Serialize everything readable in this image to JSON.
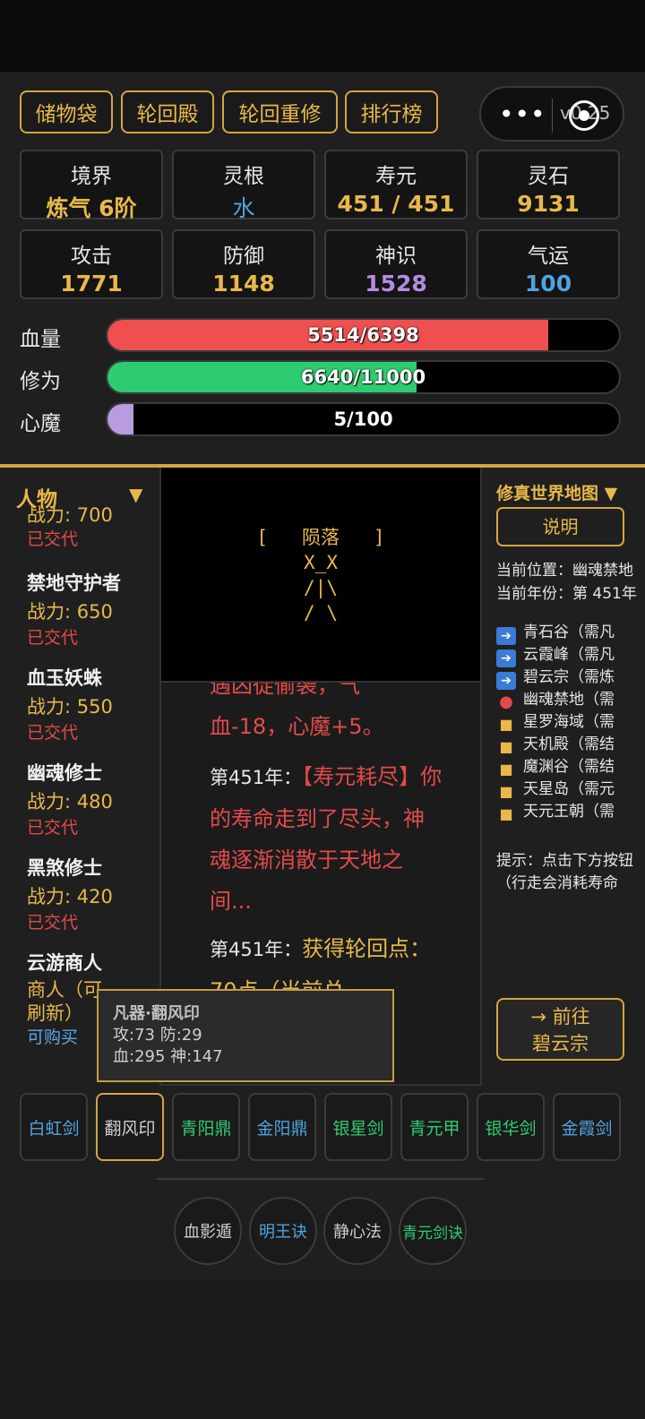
{
  "top_buttons": [
    "储物袋",
    "轮回殿",
    "轮回重修",
    "排行榜"
  ],
  "capsule": {
    "more": "•••",
    "version": "v0.25"
  },
  "stats": [
    {
      "label": "境界",
      "value": "炼气 6阶",
      "color": "#e8b84a"
    },
    {
      "label": "灵根",
      "value": "水",
      "color": "#4ea3e0"
    },
    {
      "label": "寿元",
      "value": "451 / 451",
      "color": "#e8b84a"
    },
    {
      "label": "灵石",
      "value": "9131",
      "color": "#e8b84a"
    },
    {
      "label": "攻击",
      "value": "1771",
      "color": "#e8b84a"
    },
    {
      "label": "防御",
      "value": "1148",
      "color": "#e8b84a"
    },
    {
      "label": "神识",
      "value": "1528",
      "color": "#b58be0"
    },
    {
      "label": "气运",
      "value": "100",
      "color": "#4ea3e0"
    }
  ],
  "bars": [
    {
      "label": "血量",
      "text": "5514/6398",
      "fraction": 0.862,
      "color": "#f04f4f"
    },
    {
      "label": "修为",
      "text": "6640/11000",
      "fraction": 0.604,
      "color": "#2ecc71"
    },
    {
      "label": "心魔",
      "text": "5/100",
      "fraction": 0.05,
      "color": "#b99be0"
    }
  ],
  "people": {
    "title": "人物",
    "toggle": "▼",
    "list": [
      {
        "name": "",
        "power": "战力: 700",
        "status": "已交代"
      },
      {
        "name": "禁地守护者",
        "power": "战力: 650",
        "status": "已交代"
      },
      {
        "name": "血玉妖蛛",
        "power": "战力: 550",
        "status": "已交代"
      },
      {
        "name": "幽魂修士",
        "power": "战力: 480",
        "status": "已交代"
      },
      {
        "name": "黑煞修士",
        "power": "战力: 420",
        "status": "已交代"
      },
      {
        "name": "云游商人",
        "power": "商人（可刷新）",
        "status": "可购买"
      }
    ]
  },
  "death_art": "[   陨落   ]\n X_X \n/|\\\n/ \\",
  "log": {
    "partial_top": "遇凶徒偷袭，气",
    "line1": "血-18，心魔+5。",
    "entry2_year": "第451年：",
    "entry2_text_a": "【寿元耗",
    "entry2_text_b": "尽】你的寿命走到了尽头，神魂逐渐消散于天地之间...",
    "entry3_year": "第451年：",
    "entry3_text": "获得轮回点：70点（当前总"
  },
  "map": {
    "title": "修真世界地图 ▼",
    "explain": "说明",
    "current_location": "当前位置：幽魂禁地",
    "current_year": "当前年份：第 451年",
    "locations": [
      {
        "icon": "arrow",
        "text": "青石谷（需凡"
      },
      {
        "icon": "arrow",
        "text": "云霞峰（需凡"
      },
      {
        "icon": "arrow",
        "text": "碧云宗（需炼"
      },
      {
        "icon": "pin",
        "text": "幽魂禁地（需"
      },
      {
        "icon": "lock",
        "text": "星罗海域（需"
      },
      {
        "icon": "lock",
        "text": "天机殿（需结"
      },
      {
        "icon": "lock",
        "text": "魔渊谷（需结"
      },
      {
        "icon": "lock",
        "text": "天星岛（需元"
      },
      {
        "icon": "lock",
        "text": "天元王朝（需"
      }
    ],
    "tip1": "提示：点击下方按钮",
    "tip2": "（行走会消耗寿命",
    "goto_line1": "→  前往",
    "goto_line2": "碧云宗"
  },
  "tooltip": {
    "title": "凡器·翻风印",
    "line1": "攻:73 防:29",
    "line2": "血:295 神:147"
  },
  "items": [
    {
      "name": "白虹剑",
      "color": "#4ea3e0"
    },
    {
      "name": "翻风印",
      "color": "#cfcfcf"
    },
    {
      "name": "青阳鼎",
      "color": "#2ecc71"
    },
    {
      "name": "金阳鼎",
      "color": "#4ea3e0"
    },
    {
      "name": "银星剑",
      "color": "#2ecc71"
    },
    {
      "name": "青元甲",
      "color": "#2ecc71"
    },
    {
      "name": "银华剑",
      "color": "#2ecc71"
    },
    {
      "name": "金霞剑",
      "color": "#4ea3e0"
    }
  ],
  "skills": [
    {
      "name": "血影遁",
      "color": "#cfcfcf"
    },
    {
      "name": "明王诀",
      "color": "#4ea3e0"
    },
    {
      "name": "静心法",
      "color": "#cfcfcf"
    },
    {
      "name": "青元剑诀",
      "color": "#2ecc71"
    }
  ]
}
